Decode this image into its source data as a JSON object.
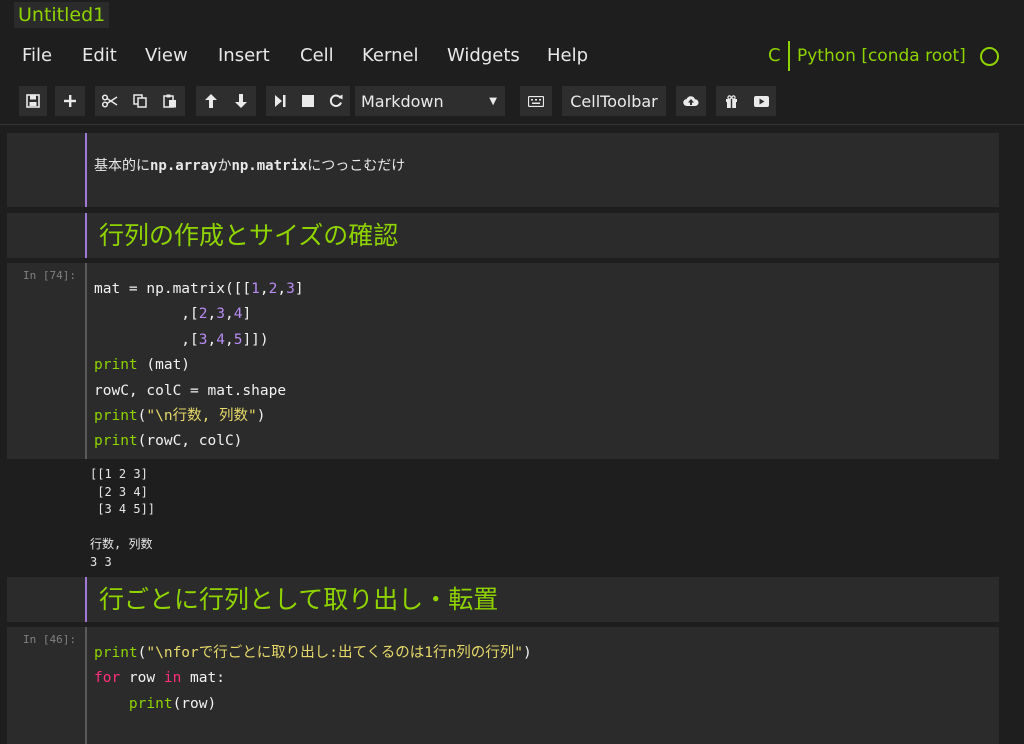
{
  "notebook": {
    "title": "Untitled1"
  },
  "menu": [
    "File",
    "Edit",
    "View",
    "Insert",
    "Cell",
    "Kernel",
    "Widgets",
    "Help"
  ],
  "kernel": {
    "indicator": "C",
    "name": "Python [conda root]"
  },
  "toolbar": {
    "cell_type": "Markdown",
    "celltoolbar_label": "CellToolbar",
    "icons": [
      "save-icon",
      "plus-icon",
      "cut-icon",
      "copy-icon",
      "paste-icon",
      "arrow-up-icon",
      "arrow-down-icon",
      "step-forward-icon",
      "stop-icon",
      "restart-icon",
      "keyboard-icon",
      "upload-icon",
      "gift-icon",
      "play-video-icon"
    ]
  },
  "cells": {
    "md1": {
      "pre1": "基本的に",
      "code1": "np.array",
      "mid": "か",
      "code2": "np.matrix",
      "post": "につっこむだけ"
    },
    "h1": {
      "text": "行列の作成とサイズの確認"
    },
    "code1": {
      "prompt": "In [74]:",
      "lines": [
        "mat = np.matrix([[1,2,3]",
        "          ,[2,3,4]",
        "          ,[3,4,5]])",
        "print (mat)",
        "rowC, colC = mat.shape",
        "print(\"\\n行数, 列数\")",
        "print(rowC, colC)"
      ],
      "output": "[[1 2 3]\n [2 3 4]\n [3 4 5]]\n\n行数, 列数\n3 3"
    },
    "h2": {
      "text": "行ごとに行列として取り出し・転置"
    },
    "code2": {
      "prompt": "In [46]:",
      "lines": [
        "print(\"\\nforで行ごとに取り出し:出てくるのは1行n列の行列\")",
        "for row in mat:",
        "    print(row)"
      ]
    }
  },
  "colors": {
    "accent": "#8fd400",
    "markdown_bar": "#a078d8",
    "keyword": "#8fd400",
    "keyword_flow": "#ff2f7a",
    "number": "#b68cf0",
    "string": "#e6d96a"
  }
}
